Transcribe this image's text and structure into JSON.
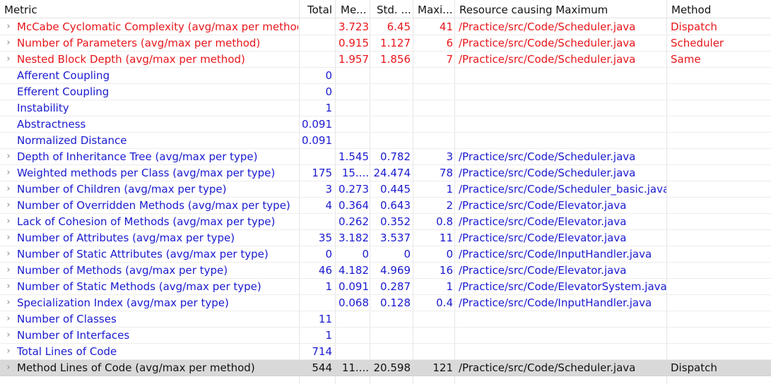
{
  "columns": {
    "metric": "Metric",
    "total": "Total",
    "mean": "Me...",
    "std": "Std. ...",
    "max": "Maxi...",
    "resource": "Resource causing Maximum",
    "method": "Method"
  },
  "colors": {
    "violation": "#e8161b",
    "normal": "#1a1ad0",
    "selected_text": "#111111",
    "selected_bg": "#d9d9d9"
  },
  "rows": [
    {
      "metric": "McCabe Cyclomatic Complexity (avg/max per method)",
      "total": "",
      "mean": "3.723",
      "std": "6.45",
      "max": "41",
      "resource": "/Practice/src/Code/Scheduler.java",
      "method": "Dispatch",
      "status": "violation",
      "expandable": true
    },
    {
      "metric": "Number of Parameters (avg/max per method)",
      "total": "",
      "mean": "0.915",
      "std": "1.127",
      "max": "6",
      "resource": "/Practice/src/Code/Scheduler.java",
      "method": "Scheduler",
      "status": "violation",
      "expandable": true
    },
    {
      "metric": "Nested Block Depth (avg/max per method)",
      "total": "",
      "mean": "1.957",
      "std": "1.856",
      "max": "7",
      "resource": "/Practice/src/Code/Scheduler.java",
      "method": "Same",
      "status": "violation",
      "expandable": true
    },
    {
      "metric": "Afferent Coupling",
      "total": "0",
      "mean": "",
      "std": "",
      "max": "",
      "resource": "",
      "method": "",
      "status": "normal",
      "expandable": false
    },
    {
      "metric": "Efferent Coupling",
      "total": "0",
      "mean": "",
      "std": "",
      "max": "",
      "resource": "",
      "method": "",
      "status": "normal",
      "expandable": false
    },
    {
      "metric": "Instability",
      "total": "1",
      "mean": "",
      "std": "",
      "max": "",
      "resource": "",
      "method": "",
      "status": "normal",
      "expandable": false
    },
    {
      "metric": "Abstractness",
      "total": "0.091",
      "mean": "",
      "std": "",
      "max": "",
      "resource": "",
      "method": "",
      "status": "normal",
      "expandable": false
    },
    {
      "metric": "Normalized Distance",
      "total": "0.091",
      "mean": "",
      "std": "",
      "max": "",
      "resource": "",
      "method": "",
      "status": "normal",
      "expandable": false
    },
    {
      "metric": "Depth of Inheritance Tree (avg/max per type)",
      "total": "",
      "mean": "1.545",
      "std": "0.782",
      "max": "3",
      "resource": "/Practice/src/Code/Scheduler.java",
      "method": "",
      "status": "normal",
      "expandable": true
    },
    {
      "metric": "Weighted methods per Class (avg/max per type)",
      "total": "175",
      "mean": "15....",
      "std": "24.474",
      "max": "78",
      "resource": "/Practice/src/Code/Scheduler.java",
      "method": "",
      "status": "normal",
      "expandable": true
    },
    {
      "metric": "Number of Children (avg/max per type)",
      "total": "3",
      "mean": "0.273",
      "std": "0.445",
      "max": "1",
      "resource": "/Practice/src/Code/Scheduler_basic.java",
      "method": "",
      "status": "normal",
      "expandable": true
    },
    {
      "metric": "Number of Overridden Methods (avg/max per type)",
      "total": "4",
      "mean": "0.364",
      "std": "0.643",
      "max": "2",
      "resource": "/Practice/src/Code/Elevator.java",
      "method": "",
      "status": "normal",
      "expandable": true
    },
    {
      "metric": "Lack of Cohesion of Methods (avg/max per type)",
      "total": "",
      "mean": "0.262",
      "std": "0.352",
      "max": "0.8",
      "resource": "/Practice/src/Code/Elevator.java",
      "method": "",
      "status": "normal",
      "expandable": true
    },
    {
      "metric": "Number of Attributes (avg/max per type)",
      "total": "35",
      "mean": "3.182",
      "std": "3.537",
      "max": "11",
      "resource": "/Practice/src/Code/Elevator.java",
      "method": "",
      "status": "normal",
      "expandable": true
    },
    {
      "metric": "Number of Static Attributes (avg/max per type)",
      "total": "0",
      "mean": "0",
      "std": "0",
      "max": "0",
      "resource": "/Practice/src/Code/InputHandler.java",
      "method": "",
      "status": "normal",
      "expandable": true
    },
    {
      "metric": "Number of Methods (avg/max per type)",
      "total": "46",
      "mean": "4.182",
      "std": "4.969",
      "max": "16",
      "resource": "/Practice/src/Code/Elevator.java",
      "method": "",
      "status": "normal",
      "expandable": true
    },
    {
      "metric": "Number of Static Methods (avg/max per type)",
      "total": "1",
      "mean": "0.091",
      "std": "0.287",
      "max": "1",
      "resource": "/Practice/src/Code/ElevatorSystem.java",
      "method": "",
      "status": "normal",
      "expandable": true
    },
    {
      "metric": "Specialization Index (avg/max per type)",
      "total": "",
      "mean": "0.068",
      "std": "0.128",
      "max": "0.4",
      "resource": "/Practice/src/Code/InputHandler.java",
      "method": "",
      "status": "normal",
      "expandable": true
    },
    {
      "metric": "Number of Classes",
      "total": "11",
      "mean": "",
      "std": "",
      "max": "",
      "resource": "",
      "method": "",
      "status": "normal",
      "expandable": true
    },
    {
      "metric": "Number of Interfaces",
      "total": "1",
      "mean": "",
      "std": "",
      "max": "",
      "resource": "",
      "method": "",
      "status": "normal",
      "expandable": true
    },
    {
      "metric": "Total Lines of Code",
      "total": "714",
      "mean": "",
      "std": "",
      "max": "",
      "resource": "",
      "method": "",
      "status": "normal",
      "expandable": true
    },
    {
      "metric": "Method Lines of Code (avg/max per method)",
      "total": "544",
      "mean": "11....",
      "std": "20.598",
      "max": "121",
      "resource": "/Practice/src/Code/Scheduler.java",
      "method": "Dispatch",
      "status": "selected",
      "expandable": true
    }
  ]
}
